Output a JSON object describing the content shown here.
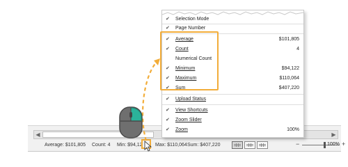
{
  "menu": {
    "items": [
      {
        "label": "Selection Mode",
        "checked": true,
        "value": ""
      },
      {
        "label": "Page Number",
        "checked": true,
        "value": ""
      },
      {
        "label": "Average",
        "checked": true,
        "value": "$101,805"
      },
      {
        "label": "Count",
        "checked": true,
        "value": "4"
      },
      {
        "label": "Numerical Count",
        "checked": false,
        "value": ""
      },
      {
        "label": "Minimum",
        "checked": true,
        "value": "$94,122"
      },
      {
        "label": "Maximum",
        "checked": true,
        "value": "$110,064"
      },
      {
        "label": "Sum",
        "checked": true,
        "value": "$407,220"
      },
      {
        "label": "Upload Status",
        "checked": true,
        "value": ""
      },
      {
        "label": "View Shortcuts",
        "checked": true,
        "value": ""
      },
      {
        "label": "Zoom Slider",
        "checked": true,
        "value": ""
      },
      {
        "label": "Zoom",
        "checked": true,
        "value": "100%"
      }
    ]
  },
  "statusbar": {
    "average": "Average: $101,805",
    "count": "Count: 4",
    "min": "Min: $94,12",
    "max": "Max: $110,064",
    "sum": "Sum: $407,220",
    "zoom_minus": "−",
    "zoom_plus": "+",
    "zoom": "100%"
  },
  "icons": {
    "check": "✔",
    "scroll_left": "◀",
    "scroll_right": "▶"
  },
  "colors": {
    "highlight": "#f2ad3a",
    "mouse_button": "#2bb39a",
    "mouse_body": "#6f6f6f"
  }
}
